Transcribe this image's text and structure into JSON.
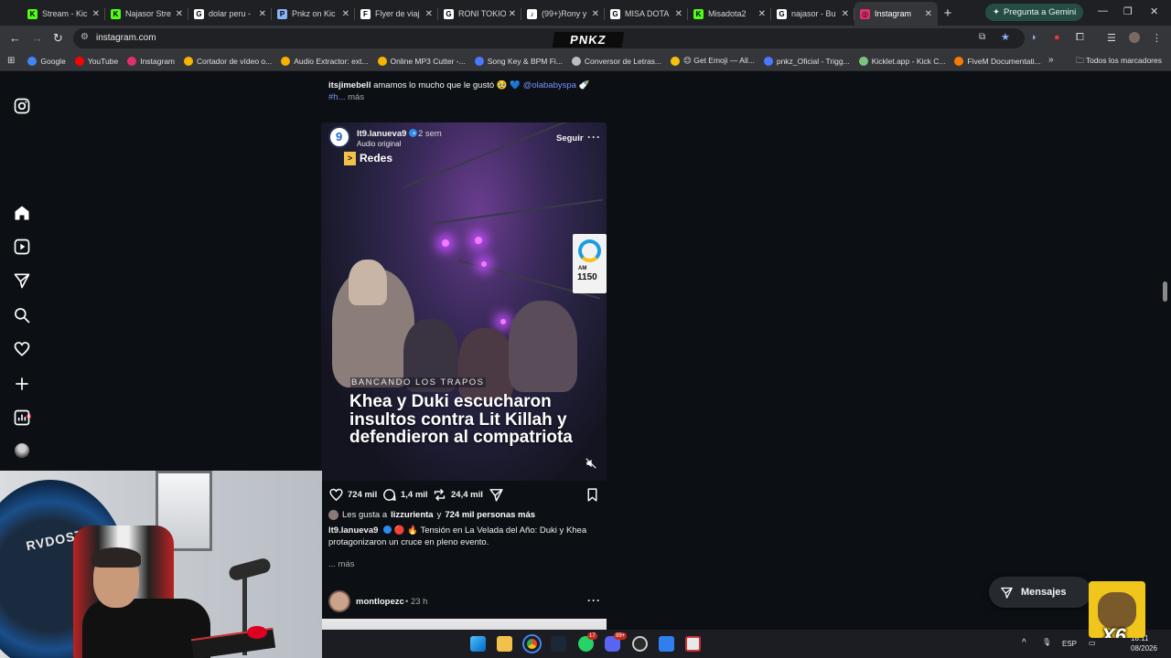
{
  "browser": {
    "tabs": [
      {
        "label": "Stream - Kic",
        "favicon_color": "#53fc18",
        "favicon_glyph": "K",
        "active": false
      },
      {
        "label": "Najasor Stre",
        "favicon_color": "#53fc18",
        "favicon_glyph": "K",
        "active": false
      },
      {
        "label": "dolar peru -",
        "favicon_color": "#ffffff",
        "favicon_glyph": "G",
        "active": false
      },
      {
        "label": "Pnkz on Kic",
        "favicon_color": "#8ab4f8",
        "favicon_glyph": "P",
        "active": false
      },
      {
        "label": "Flyer de viaj",
        "favicon_color": "#ffffff",
        "favicon_glyph": "F",
        "active": false
      },
      {
        "label": "RONI TOKIO",
        "favicon_color": "#ffffff",
        "favicon_glyph": "G",
        "active": false
      },
      {
        "label": "(99+)Rony y",
        "favicon_color": "#ffffff",
        "favicon_glyph": "♪",
        "active": false
      },
      {
        "label": "MISA DOTA",
        "favicon_color": "#ffffff",
        "favicon_glyph": "G",
        "active": false
      },
      {
        "label": "Misadota2",
        "favicon_color": "#53fc18",
        "favicon_glyph": "K",
        "active": false
      },
      {
        "label": "najasor - Bu",
        "favicon_color": "#ffffff",
        "favicon_glyph": "G",
        "active": false
      },
      {
        "label": "Instagram",
        "favicon_color": "#e1306c",
        "favicon_glyph": "◎",
        "active": true
      }
    ],
    "new_tab_label": "+",
    "gemini_label": "Pregunta a Gemini",
    "url": "instagram.com",
    "overlay_brand": "PNKZ",
    "bookmarks": [
      {
        "label": "Google",
        "color": "#4285f4"
      },
      {
        "label": "YouTube",
        "color": "#ff0000"
      },
      {
        "label": "Instagram",
        "color": "#e1306c"
      },
      {
        "label": "Cortador de vídeo o...",
        "color": "#f4b400"
      },
      {
        "label": "Audio Extractor: ext...",
        "color": "#f4b400"
      },
      {
        "label": "Online MP3 Cutter -...",
        "color": "#f4b400"
      },
      {
        "label": "Song Key & BPM Fi...",
        "color": "#4a78ff"
      },
      {
        "label": "Conversor de Letras...",
        "color": "#bdbdbd"
      },
      {
        "label": "😊 Get Emoji — All...",
        "color": "#f4c20d"
      },
      {
        "label": "pnkz_Oficial - Trigg...",
        "color": "#4a78ff"
      },
      {
        "label": "Kicklet.app - Kick C...",
        "color": "#7bc47f"
      },
      {
        "label": "FiveM Documentati...",
        "color": "#f57c00"
      }
    ],
    "bookmarks_more": "»",
    "all_bookmarks": "Todos los marcadores"
  },
  "feed": {
    "prev_caption": {
      "user": "itsjimebell",
      "text": "amamos lo mucho que le gustó 🥹 💙",
      "mention": "@olababyspa",
      "emoji": "🍼",
      "hashtag": "#h...",
      "more": "más"
    },
    "post": {
      "username": "lt9.lanueva9",
      "time": "• 2 sem",
      "audio": "Audio original",
      "follow_label": "Seguir",
      "tag": "Redes",
      "tag_arrow": ">",
      "station_am": "AM",
      "station_number": "1150",
      "kicker": "BANCANDO LOS TRAPOS",
      "headline": "Khea y Duki escucharon insultos contra Lit Killah y defendieron al compatriota",
      "likes": "724 mil",
      "comments": "1,4 mil",
      "reposts": "24,4 mil",
      "liked_by_prefix": "Les gusta a",
      "liked_by_user": "lizzurienta",
      "liked_by_join": "y",
      "liked_by_rest": "724 mil personas más",
      "caption_user": "lt9.lanueva9",
      "caption_emojis": "🔴 🔥",
      "caption_text": "Tensión en La Velada del Año: Duki y Khea protagonizaron un cruce en pleno evento.",
      "more": "... más"
    },
    "next_post": {
      "username": "montlopezc",
      "time": "• 23 h"
    }
  },
  "messages_label": "Mensajes",
  "webcam": {
    "wall_text": "RVDOST"
  },
  "emote_text": "X6",
  "taskbar": {
    "whatsapp_badge": "17",
    "discord_badge": "99+",
    "language": "ESP",
    "time": "18:11",
    "date": "08/2026"
  }
}
